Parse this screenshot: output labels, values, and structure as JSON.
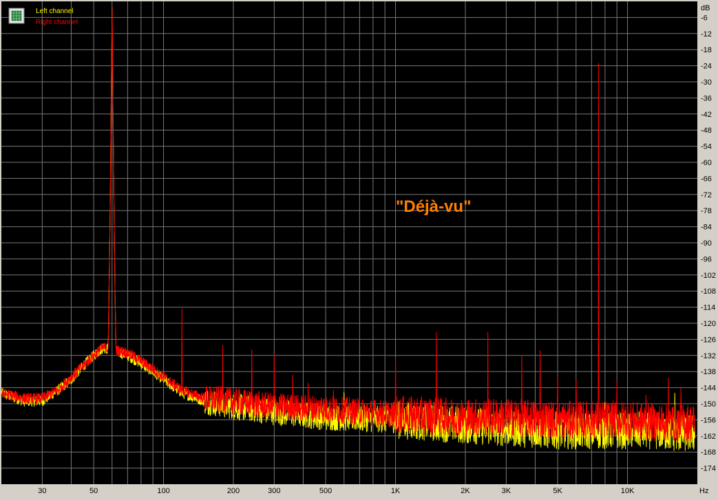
{
  "chart_data": {
    "type": "line",
    "xscale": "log",
    "xlim": [
      20,
      20000
    ],
    "ylim": [
      -180,
      0
    ],
    "grid": true,
    "legend_position": "top-left",
    "y_unit": "dB",
    "x_unit": "Hz",
    "y_ticks": [
      -6,
      -12,
      -18,
      -24,
      -30,
      -36,
      -42,
      -48,
      -54,
      -60,
      -66,
      -72,
      -78,
      -84,
      -90,
      -96,
      -102,
      -108,
      -114,
      -120,
      -126,
      -132,
      -138,
      -144,
      -150,
      -156,
      -162,
      -168,
      -174
    ],
    "y_tick_labels": [
      "-6",
      "-12",
      "-18",
      "-24",
      "-30",
      "-36",
      "-42",
      "-48",
      "-54",
      "-60",
      "-66",
      "-72",
      "-78",
      "-84",
      "-90",
      "-96",
      "-102",
      "-108",
      "-114",
      "-120",
      "-126",
      "-132",
      "-138",
      "-144",
      "-150",
      "-156",
      "-162",
      "-168",
      "-174"
    ],
    "x_ticks": [
      30,
      50,
      100,
      200,
      300,
      500,
      1000,
      2000,
      3000,
      5000,
      10000
    ],
    "x_tick_labels": [
      "30",
      "50",
      "100",
      "200",
      "300",
      "500",
      "1K",
      "2K",
      "3K",
      "5K",
      "10K"
    ],
    "annotation": "\"Déjà-vu\"",
    "series": [
      {
        "name": "Left channel",
        "color": "#ffff00",
        "baseline": [
          [
            20,
            -146
          ],
          [
            25,
            -149
          ],
          [
            30,
            -149
          ],
          [
            35,
            -145
          ],
          [
            40,
            -141
          ],
          [
            45,
            -136
          ],
          [
            50,
            -132
          ],
          [
            55,
            -129
          ],
          [
            70,
            -132
          ],
          [
            80,
            -135
          ],
          [
            100,
            -141
          ],
          [
            120,
            -146
          ],
          [
            150,
            -149
          ],
          [
            200,
            -151
          ],
          [
            300,
            -153
          ],
          [
            500,
            -155
          ],
          [
            1000,
            -156
          ],
          [
            2000,
            -158
          ],
          [
            3000,
            -159
          ],
          [
            5000,
            -160
          ],
          [
            7000,
            -160
          ],
          [
            10000,
            -160
          ],
          [
            13000,
            -160
          ],
          [
            16000,
            -161
          ],
          [
            19000,
            -161
          ]
        ],
        "peaks": [
          [
            60,
            -2
          ],
          [
            180,
            -141
          ],
          [
            300,
            -143
          ],
          [
            600,
            -145
          ],
          [
            1200,
            -150
          ],
          [
            8000,
            -136
          ],
          [
            16000,
            -138
          ]
        ]
      },
      {
        "name": "Right channel",
        "color": "#ff0000",
        "baseline": [
          [
            20,
            -146
          ],
          [
            25,
            -148
          ],
          [
            30,
            -148
          ],
          [
            35,
            -145
          ],
          [
            40,
            -140
          ],
          [
            45,
            -136
          ],
          [
            50,
            -132
          ],
          [
            55,
            -129
          ],
          [
            70,
            -131
          ],
          [
            80,
            -134
          ],
          [
            100,
            -140
          ],
          [
            120,
            -145
          ],
          [
            150,
            -148
          ],
          [
            200,
            -149
          ],
          [
            300,
            -151
          ],
          [
            500,
            -152
          ],
          [
            1000,
            -154
          ],
          [
            2000,
            -155
          ],
          [
            3000,
            -155
          ],
          [
            5000,
            -156
          ],
          [
            7000,
            -156
          ],
          [
            10000,
            -156
          ],
          [
            13000,
            -157
          ],
          [
            16000,
            -157
          ],
          [
            19000,
            -157
          ]
        ],
        "peaks": [
          [
            60,
            -2
          ],
          [
            120,
            -109
          ],
          [
            180,
            -127
          ],
          [
            240,
            -122
          ],
          [
            300,
            -131
          ],
          [
            360,
            -138
          ],
          [
            420,
            -140
          ],
          [
            480,
            -142
          ],
          [
            540,
            -144
          ],
          [
            1000,
            -128
          ],
          [
            1500,
            -122
          ],
          [
            2500,
            -123
          ],
          [
            3500,
            -128
          ],
          [
            4200,
            -130
          ],
          [
            5000,
            -136
          ],
          [
            6000,
            -135
          ],
          [
            7500,
            -17
          ],
          [
            9000,
            -140
          ],
          [
            12000,
            -140
          ],
          [
            15000,
            -137
          ],
          [
            17000,
            -140
          ]
        ]
      }
    ]
  }
}
